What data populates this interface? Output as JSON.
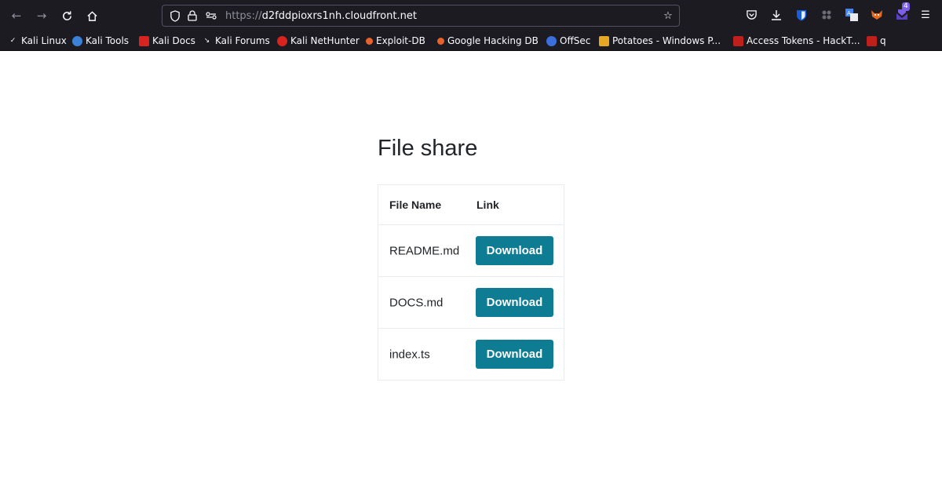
{
  "browser": {
    "url_scheme": "https://",
    "url_host": "d2fddpioxrs1nh.cloudfront.net",
    "toolbar_icons": [
      "back-icon",
      "forward-icon",
      "reload-icon",
      "home-icon",
      "shield-icon",
      "lock-icon",
      "permissions-icon",
      "bookmark-star-icon",
      "pocket-icon",
      "downloads-icon",
      "bitwarden-icon",
      "extension-icon",
      "translate-icon",
      "foxyproxy-icon",
      "tab-counter-icon",
      "menu-icon"
    ],
    "tab_counter_badge": "4",
    "colors": {
      "chrome_bg": "#1c1b22",
      "chrome_text": "#fbfbfe",
      "muted": "#8f8f9d"
    }
  },
  "bookmarks": [
    {
      "label": "Kali Linux",
      "icon": "kali-dragon-icon",
      "color": "#2f7bd3"
    },
    {
      "label": "Kali Tools",
      "icon": "kali-tools-icon",
      "color": "#3b82d6"
    },
    {
      "label": "Kali Docs",
      "icon": "kali-docs-icon",
      "color": "#d8231e"
    },
    {
      "label": "Kali Forums",
      "icon": "kali-forums-icon",
      "color": "#2f2f2f"
    },
    {
      "label": "Kali NetHunter",
      "icon": "nethunter-icon",
      "color": "#d8231e"
    },
    {
      "label": "Exploit-DB",
      "icon": "exploitdb-icon",
      "color": "#e8632b"
    },
    {
      "label": "Google Hacking DB",
      "icon": "ghdb-icon",
      "color": "#e8632b"
    },
    {
      "label": "OffSec",
      "icon": "offsec-icon",
      "color": "#3b6fd9"
    },
    {
      "label": "Potatoes - Windows P...",
      "icon": "potato-icon",
      "color": "#e6a823"
    },
    {
      "label": "Access Tokens - HackT...",
      "icon": "hacktricks-icon",
      "color": "#c0201c"
    },
    {
      "label": "q",
      "icon": "hacktricks-icon",
      "color": "#c0201c"
    }
  ],
  "page": {
    "title": "File share",
    "table": {
      "headers": [
        "File Name",
        "Link"
      ],
      "rows": [
        {
          "name": "README.md",
          "action": "Download"
        },
        {
          "name": "DOCS.md",
          "action": "Download"
        },
        {
          "name": "index.ts",
          "action": "Download"
        }
      ]
    },
    "colors": {
      "button": "#0e7c93",
      "text": "#212529",
      "border": "#e9ecef"
    }
  }
}
